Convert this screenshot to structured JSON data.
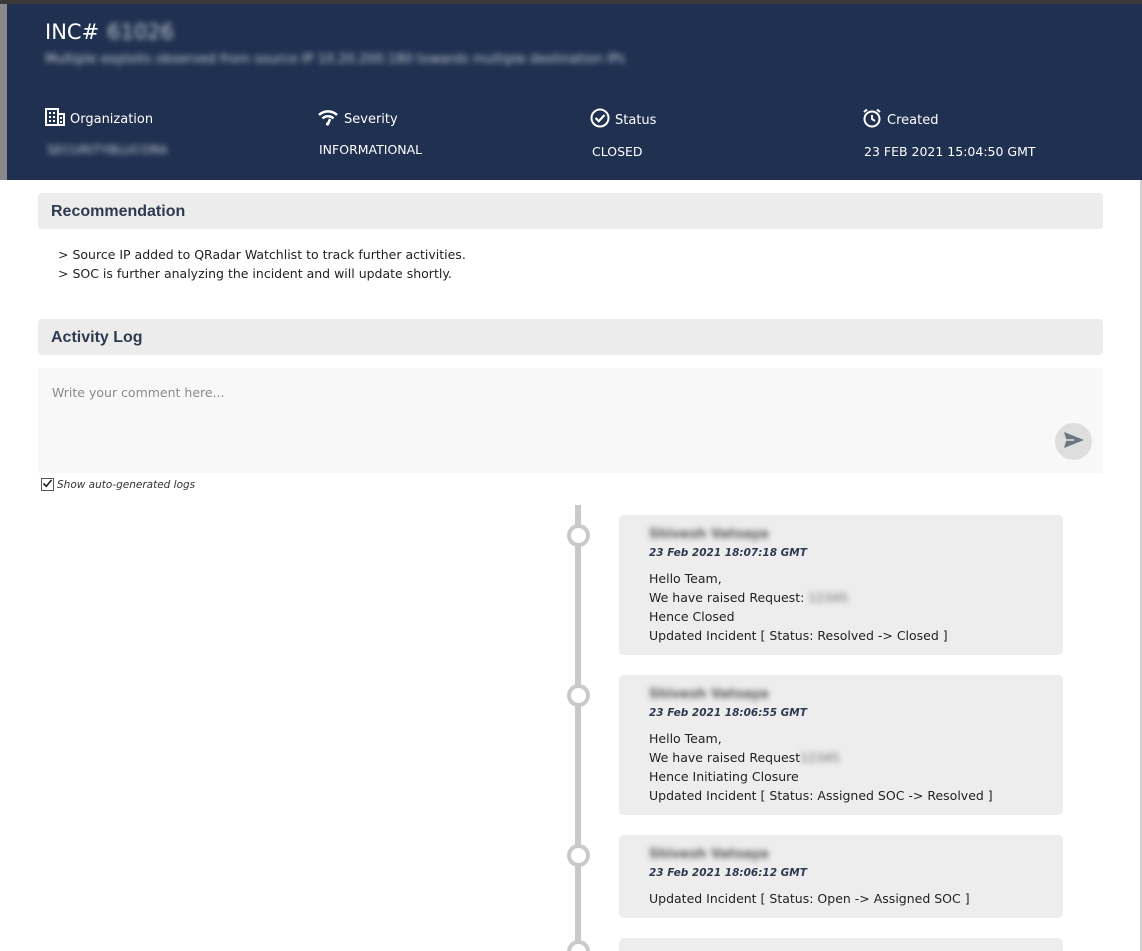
{
  "header": {
    "inc_label": "INC#",
    "inc_number": "61026",
    "subtitle": "Multiple exploits observed from source IP 10.20.200.180 towards multiple destination IPs",
    "organization": {
      "label": "Organization",
      "value": "SECURITYBLUCORA"
    },
    "severity": {
      "label": "Severity",
      "value": "INFORMATIONAL"
    },
    "status": {
      "label": "Status",
      "value": "CLOSED"
    },
    "created": {
      "label": "Created",
      "value": "23 FEB 2021 15:04:50 GMT"
    }
  },
  "recommendation": {
    "title": "Recommendation",
    "lines": [
      "> Source IP added to QRadar Watchlist to track further activities.",
      "> SOC is further analyzing the incident and will update shortly."
    ]
  },
  "activity_log": {
    "title": "Activity Log",
    "comment_placeholder": "Write your comment here...",
    "show_auto_logs_label": "Show auto-generated logs",
    "show_auto_logs_checked": true,
    "entries": [
      {
        "author": "Shivesh Vatsaya",
        "time": "23 Feb 2021 18:07:18 GMT",
        "line1": "Hello Team,",
        "line2_prefix": "We have raised Request: ",
        "line2_redacted": "12345",
        "line3": "Hence Closed",
        "line4": "Updated Incident [ Status: Resolved -> Closed ]"
      },
      {
        "author": "Shivesh Vatsaya",
        "time": "23 Feb 2021 18:06:55 GMT",
        "line1": "Hello Team,",
        "line2_prefix": "We have raised Request",
        "line2_redacted": "12345",
        "line3": "Hence Initiating Closure",
        "line4": "Updated Incident [ Status: Assigned SOC -> Resolved ]"
      },
      {
        "author": "Shivesh Vatsaya",
        "time": "23 Feb 2021 18:06:12 GMT",
        "line1": "Updated Incident [ Status: Open -> Assigned SOC ]"
      }
    ]
  },
  "colors": {
    "header_bg": "#1f3050",
    "section_bg": "#ececec",
    "timeline": "#c9c9c9"
  },
  "icons": {
    "organization": "building-icon",
    "severity": "signal-icon",
    "status": "check-circle-icon",
    "created": "alarm-clock-icon",
    "send": "send-icon",
    "checkbox": "checkmark-icon"
  }
}
